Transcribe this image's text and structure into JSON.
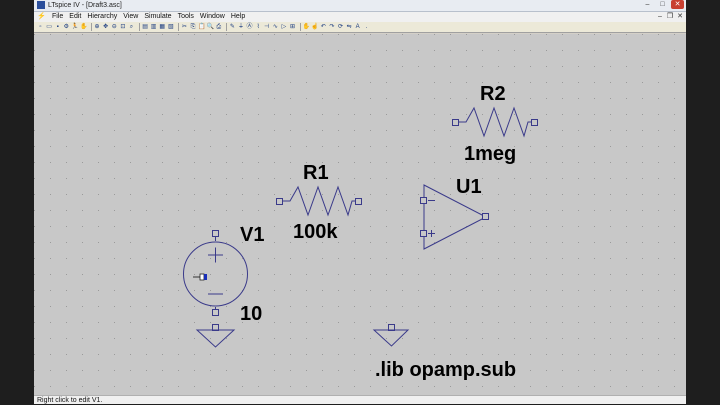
{
  "window": {
    "title": "LTspice IV - [Draft3.asc]",
    "minimize": "–",
    "maximize": "□",
    "close": "✕"
  },
  "menubar": {
    "items": [
      {
        "label": "File"
      },
      {
        "label": "Edit"
      },
      {
        "label": "Hierarchy"
      },
      {
        "label": "View"
      },
      {
        "label": "Simulate"
      },
      {
        "label": "Tools"
      },
      {
        "label": "Window"
      },
      {
        "label": "Help"
      }
    ]
  },
  "schematic": {
    "v1": {
      "name": "V1",
      "value": "10"
    },
    "r1": {
      "name": "R1",
      "value": "100k"
    },
    "r2": {
      "name": "R2",
      "value": "1meg"
    },
    "u1": {
      "name": "U1"
    },
    "directive": ".lib opamp.sub"
  },
  "status": {
    "text": "Right click to edit V1."
  }
}
